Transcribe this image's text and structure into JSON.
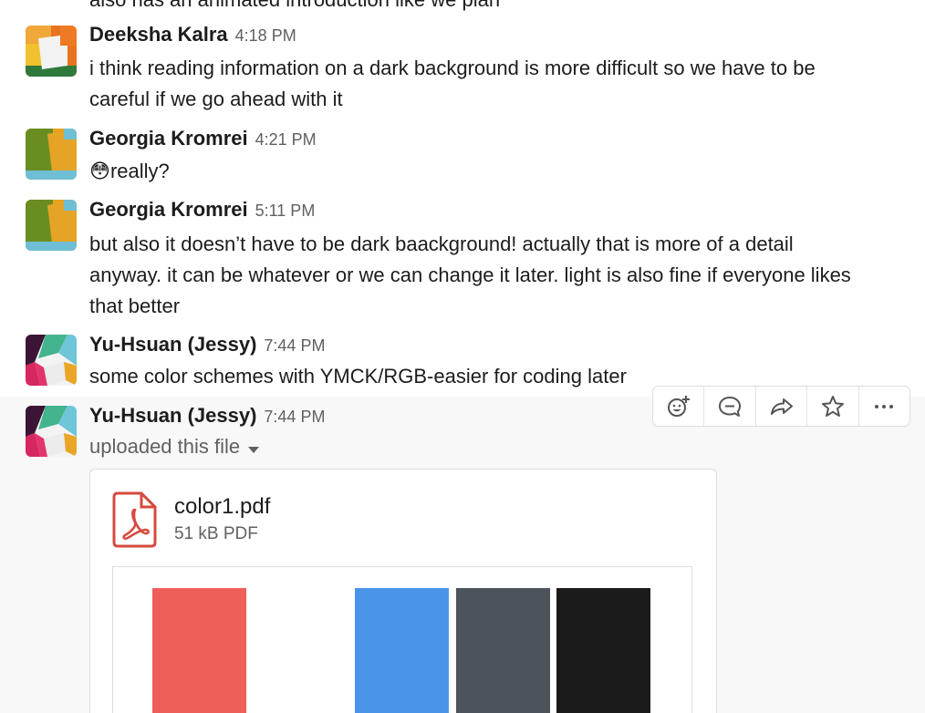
{
  "partial_message": {
    "text": "also has an animated introduction like we plan"
  },
  "messages": [
    {
      "author": "Deeksha Kalra",
      "time": "4:18 PM",
      "lines": [
        "i think reading information on a dark background is more difficult so we have to be",
        "careful if we go ahead with it"
      ]
    },
    {
      "author": "Georgia Kromrei",
      "time": "4:21 PM",
      "emoji": "😳",
      "lines": [
        "really?"
      ]
    },
    {
      "author": "Georgia Kromrei",
      "time": "5:11 PM",
      "lines": [
        "but also it doesn’t have to be dark baackground! actually that is more of a detail",
        "anyway. it can be whatever or we can change it later. light is also fine if everyone likes",
        "that better"
      ]
    },
    {
      "author": "Yu-Hsuan (Jessy)",
      "time": "7:44 PM",
      "lines": [
        "some color schemes with YMCK/RGB-easier for coding later"
      ]
    },
    {
      "author": "Yu-Hsuan (Jessy)",
      "time": "7:44 PM",
      "action": "uploaded this file"
    }
  ],
  "toolbar": {
    "buttons": [
      "add-reaction-icon",
      "start-thread-icon",
      "share-message-icon",
      "star-icon",
      "more-actions-icon"
    ]
  },
  "file": {
    "name": "color1.pdf",
    "meta": "51 kB PDF",
    "swatch_colors": [
      "#ef5f5a",
      "#4a95ea",
      "#4c535a",
      "#1b1b1b"
    ]
  },
  "colors": {
    "pdf_red": "#d64a3f",
    "hover_bg": "#f8f8f8"
  }
}
